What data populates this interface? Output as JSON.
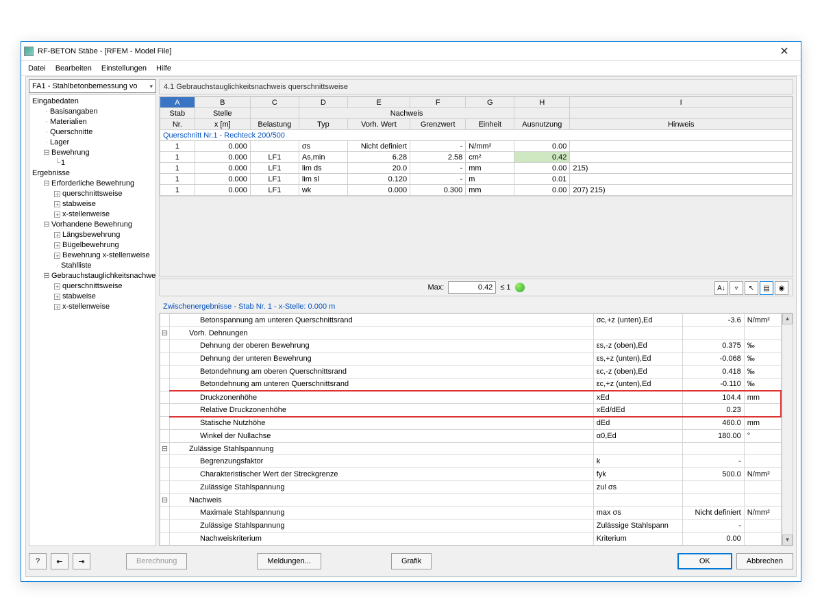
{
  "window": {
    "title": "RF-BETON Stäbe - [RFEM - Model File]"
  },
  "menu": {
    "file": "Datei",
    "edit": "Bearbeiten",
    "settings": "Einstellungen",
    "help": "Hilfe"
  },
  "combo": {
    "value": "FA1 - Stahlbetonbemessung vo"
  },
  "tree": {
    "eingabedaten": "Eingabedaten",
    "basisangaben": "Basisangaben",
    "materialien": "Materialien",
    "querschnitte": "Querschnitte",
    "lager": "Lager",
    "bewehrung": "Bewehrung",
    "bewehrung1": "1",
    "ergebnisse": "Ergebnisse",
    "erforderlich": "Erforderliche Bewehrung",
    "querschnittsweise": "querschnittsweise",
    "stabweise": "stabweise",
    "xstellenweise": "x-stellenweise",
    "vorhandene": "Vorhandene Bewehrung",
    "laengs": "Längsbewehrung",
    "buegel": "Bügelbewehrung",
    "bew_x": "Bewehrung x-stellenweise",
    "stahlliste": "Stahlliste",
    "gebrauch": "Gebrauchstauglichkeitsnachwei",
    "g_quer": "querschnittsweise",
    "g_stab": "stabweise",
    "g_x": "x-stellenweise"
  },
  "panel": {
    "title": "4.1 Gebrauchstauglichkeitsnachweis querschnittsweise"
  },
  "grid": {
    "letters": [
      "A",
      "B",
      "C",
      "D",
      "E",
      "F",
      "G",
      "H",
      "I"
    ],
    "h1": {
      "stab": "Stab",
      "stelle": "Stelle",
      "nachweis": "Nachweis"
    },
    "h2": {
      "nr": "Nr.",
      "x": "x [m]",
      "belastung": "Belastung",
      "typ": "Typ",
      "vorh": "Vorh. Wert",
      "grenz": "Grenzwert",
      "einheit": "Einheit",
      "ausnutzung": "Ausnutzung",
      "hinweis": "Hinweis"
    },
    "section": "Querschnitt Nr.1  -  Rechteck 200/500",
    "rows": [
      {
        "nr": "1",
        "x": "0.000",
        "bel": "",
        "typ": "σs",
        "vorh": "Nicht definiert",
        "grenz": "-",
        "ein": "N/mm²",
        "aus": "0.00",
        "bar": false,
        "hin": ""
      },
      {
        "nr": "1",
        "x": "0.000",
        "bel": "LF1",
        "typ": "As,min",
        "vorh": "6.28",
        "grenz": "2.58",
        "ein": "cm²",
        "aus": "0.42",
        "bar": true,
        "hin": ""
      },
      {
        "nr": "1",
        "x": "0.000",
        "bel": "LF1",
        "typ": "lim ds",
        "vorh": "20.0",
        "grenz": "-",
        "ein": "mm",
        "aus": "0.00",
        "bar": false,
        "hin": "215)"
      },
      {
        "nr": "1",
        "x": "0.000",
        "bel": "LF1",
        "typ": "lim sl",
        "vorh": "0.120",
        "grenz": "-",
        "ein": "m",
        "aus": "0.01",
        "bar": false,
        "hin": ""
      },
      {
        "nr": "1",
        "x": "0.000",
        "bel": "LF1",
        "typ": "wk",
        "vorh": "0.000",
        "grenz": "0.300",
        "ein": "mm",
        "aus": "0.00",
        "bar": false,
        "hin": "207) 215)"
      }
    ]
  },
  "maxbar": {
    "label": "Max:",
    "value": "0.42",
    "le": "≤ 1"
  },
  "sub": {
    "title": "Zwischenergebnisse -  Stab Nr. 1  -  x-Stelle: 0.000 m"
  },
  "detail": {
    "rows": [
      {
        "c": "",
        "lbl": "Betonspannung am unteren Querschnittsrand",
        "ind": 2,
        "sym": "σc,+z (unten),Ed",
        "val": "-3.6",
        "unit": "N/mm²"
      },
      {
        "c": "⊟",
        "lbl": "Vorh. Dehnungen",
        "ind": 1,
        "sym": "",
        "val": "",
        "unit": ""
      },
      {
        "c": "",
        "lbl": "Dehnung der oberen Bewehrung",
        "ind": 2,
        "sym": "εs,-z (oben),Ed",
        "val": "0.375",
        "unit": "‰"
      },
      {
        "c": "",
        "lbl": "Dehnung der unteren Bewehrung",
        "ind": 2,
        "sym": "εs,+z (unten),Ed",
        "val": "-0.068",
        "unit": "‰"
      },
      {
        "c": "",
        "lbl": "Betondehnung am oberen Querschnittsrand",
        "ind": 2,
        "sym": "εc,-z (oben),Ed",
        "val": "0.418",
        "unit": "‰"
      },
      {
        "c": "",
        "lbl": "Betondehnung am unteren Querschnittsrand",
        "ind": 2,
        "sym": "εc,+z (unten),Ed",
        "val": "-0.110",
        "unit": "‰"
      },
      {
        "c": "",
        "lbl": "Druckzonenhöhe",
        "ind": 2,
        "sym": "xEd",
        "val": "104.4",
        "unit": "mm",
        "hl": "top"
      },
      {
        "c": "",
        "lbl": "Relative Druckzonenhöhe",
        "ind": 2,
        "sym": "xEd/dEd",
        "val": "0.23",
        "unit": "",
        "hl": "bot"
      },
      {
        "c": "",
        "lbl": "Statische Nutzhöhe",
        "ind": 2,
        "sym": "dEd",
        "val": "460.0",
        "unit": "mm"
      },
      {
        "c": "",
        "lbl": "Winkel der Nullachse",
        "ind": 2,
        "sym": "α0,Ed",
        "val": "180.00",
        "unit": "°"
      },
      {
        "c": "⊟",
        "lbl": "Zulässige Stahlspannung",
        "ind": 1,
        "sym": "",
        "val": "",
        "unit": ""
      },
      {
        "c": "",
        "lbl": "Begrenzungsfaktor",
        "ind": 2,
        "sym": "k",
        "val": "-",
        "unit": ""
      },
      {
        "c": "",
        "lbl": "Charakteristischer Wert der Streckgrenze",
        "ind": 2,
        "sym": "fyk",
        "val": "500.0",
        "unit": "N/mm²"
      },
      {
        "c": "",
        "lbl": "Zulässige Stahlspannung",
        "ind": 2,
        "sym": "zul σs",
        "val": "",
        "unit": ""
      },
      {
        "c": "⊟",
        "lbl": "Nachweis",
        "ind": 1,
        "sym": "",
        "val": "",
        "unit": ""
      },
      {
        "c": "",
        "lbl": "Maximale Stahlspannung",
        "ind": 2,
        "sym": "max σs",
        "val": "Nicht definiert",
        "unit": "N/mm²"
      },
      {
        "c": "",
        "lbl": "Zulässige Stahlspannung",
        "ind": 2,
        "sym": "Zulässige Stahlspann",
        "val": "-",
        "unit": ""
      },
      {
        "c": "",
        "lbl": "Nachweiskriterium",
        "ind": 2,
        "sym": "Kriterium",
        "val": "0.00",
        "unit": ""
      }
    ]
  },
  "buttons": {
    "berechnung": "Berechnung",
    "meldungen": "Meldungen...",
    "grafik": "Grafik",
    "ok": "OK",
    "abbrechen": "Abbrechen"
  }
}
